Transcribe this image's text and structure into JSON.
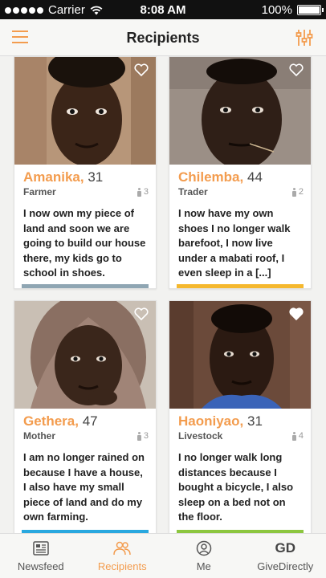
{
  "status_bar": {
    "carrier": "Carrier",
    "time": "8:08 AM",
    "battery": "100%"
  },
  "nav": {
    "title": "Recipients",
    "accent_color": "#f39c4e"
  },
  "recipients": [
    {
      "name": "Amanika,",
      "age": "31",
      "role": "Farmer",
      "family": "3",
      "quote": "I now own my piece of land and soon we are going to build our house there, my kids go to school in shoes.",
      "accent_color": "#8fa6b3",
      "favorited": false
    },
    {
      "name": "Chilemba,",
      "age": "44",
      "role": "Trader",
      "family": "2",
      "quote": "I now have my own shoes I no longer walk barefoot, I now live under a mabati roof, I even sleep in a [...]",
      "accent_color": "#f5b82e",
      "favorited": false
    },
    {
      "name": "Gethera,",
      "age": "47",
      "role": "Mother",
      "family": "3",
      "quote": "I am no longer rained on because I have a house, I also have my small piece of land and do my own farming.",
      "accent_color": "#29a8df",
      "favorited": false
    },
    {
      "name": "Haoniyao,",
      "age": "31",
      "role": "Livestock",
      "family": "4",
      "quote": "I no longer walk long distances because I bought a bicycle, I also sleep on a bed not on the floor.",
      "accent_color": "#8cc63f",
      "favorited": true
    }
  ],
  "tabs": [
    {
      "label": "Newsfeed",
      "icon": "newspaper-icon",
      "active": false
    },
    {
      "label": "Recipients",
      "icon": "people-icon",
      "active": true
    },
    {
      "label": "Me",
      "icon": "profile-icon",
      "active": false
    },
    {
      "label": "GiveDirectly",
      "icon": "gd-logo",
      "logo_text": "GD",
      "active": false
    }
  ]
}
